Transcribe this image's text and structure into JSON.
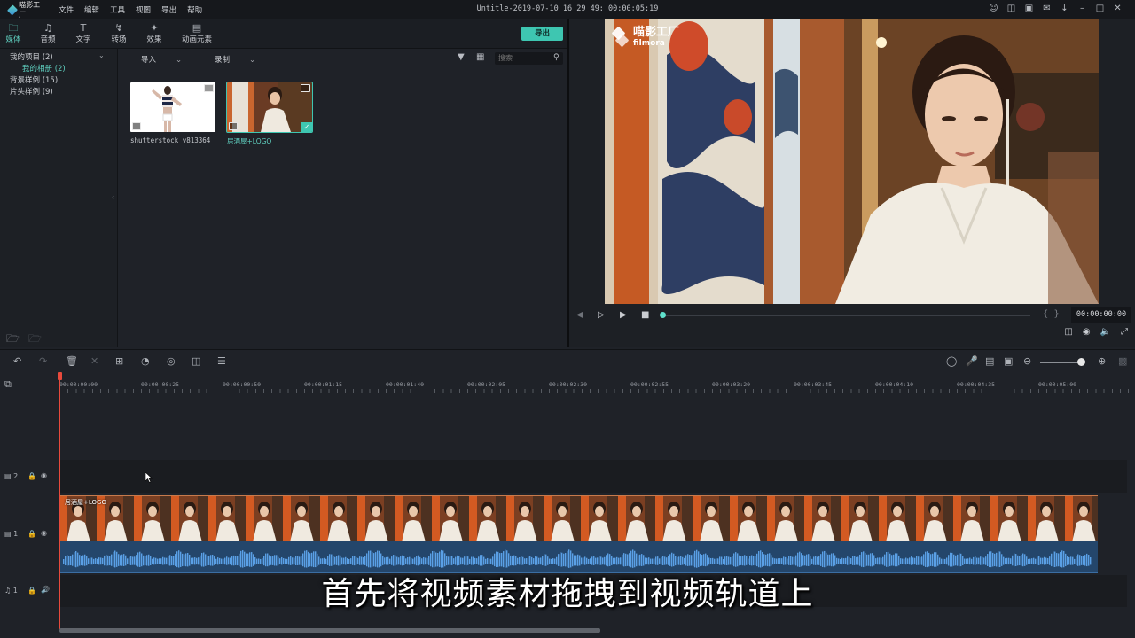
{
  "app": {
    "logo_text": "喵影工厂",
    "menu": [
      "文件",
      "编辑",
      "工具",
      "视图",
      "导出",
      "帮助"
    ],
    "document_title": "Untitle-2019-07-10 16 29 49: 00:00:05:19"
  },
  "media_tabs": [
    {
      "label": "媒体",
      "icon": "folder-icon"
    },
    {
      "label": "音频",
      "icon": "music-note-icon"
    },
    {
      "label": "文字",
      "icon": "text-icon"
    },
    {
      "label": "转场",
      "icon": "transition-icon"
    },
    {
      "label": "效果",
      "icon": "effects-icon"
    },
    {
      "label": "动画元素",
      "icon": "image-icon"
    }
  ],
  "export_label": "导出",
  "sidebar": {
    "items": [
      {
        "label": "我的项目 (2)"
      },
      {
        "label": "我的相册 (2)"
      },
      {
        "label": "背景样例 (15)"
      },
      {
        "label": "片头样例 (9)"
      }
    ]
  },
  "library_bar": {
    "import_label": "导入",
    "record_label": "录制",
    "search_placeholder": "搜索"
  },
  "library": {
    "items": [
      {
        "label": "shutterstock_v813364"
      },
      {
        "label": "居酒屋+LOGO"
      }
    ]
  },
  "preview": {
    "watermark_title": "喵影工厂",
    "watermark_sub": "filmora",
    "timecode": "00:00:00:00",
    "progress": 0
  },
  "timeline": {
    "ruler": [
      "00:00:00:00",
      "00:00:00:25",
      "00:00:00:50",
      "00:00:01:15",
      "00:00:01:40",
      "00:00:02:05",
      "00:00:02:30",
      "00:00:02:55",
      "00:00:03:20",
      "00:00:03:45",
      "00:00:04:10",
      "00:00:04:35",
      "00:00:05:00"
    ],
    "tracks": [
      {
        "label": "2"
      },
      {
        "label": "1"
      },
      {
        "label": "1"
      }
    ],
    "video_clip_label": "居酒屋+LOGO"
  },
  "subtitle": "首先将视频素材拖拽到视频轨道上",
  "colors": {
    "accent": "#3ec6b1",
    "playhead": "#e84a3c",
    "audio_clip": "#24466b"
  }
}
